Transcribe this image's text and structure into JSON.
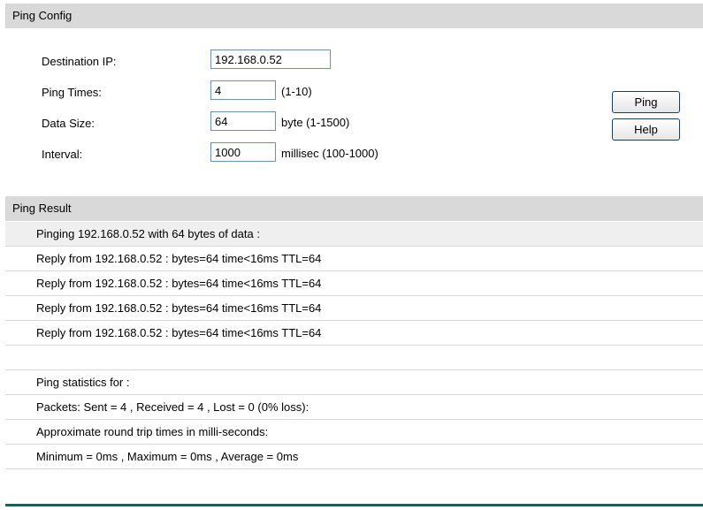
{
  "config": {
    "header": "Ping Config",
    "destination_ip": {
      "label": "Destination IP:",
      "value": "192.168.0.52"
    },
    "ping_times": {
      "label": "Ping Times:",
      "value": "4",
      "hint": "(1-10)"
    },
    "data_size": {
      "label": "Data Size:",
      "value": "64",
      "hint": "byte (1-1500)"
    },
    "interval": {
      "label": "Interval:",
      "value": "1000",
      "hint": "millisec (100-1000)"
    },
    "ping_button": "Ping",
    "help_button": "Help"
  },
  "result": {
    "header": "Ping Result",
    "rows": [
      "Pinging 192.168.0.52 with 64 bytes of data :",
      "Reply from 192.168.0.52 : bytes=64 time<16ms TTL=64",
      "Reply from 192.168.0.52 : bytes=64 time<16ms TTL=64",
      "Reply from 192.168.0.52 : bytes=64 time<16ms TTL=64",
      "Reply from 192.168.0.52 : bytes=64 time<16ms TTL=64",
      "",
      "Ping statistics for :",
      "Packets: Sent = 4 , Received = 4 , Lost = 0 (0% loss):",
      "Approximate round trip times in milli-seconds:",
      "Minimum = 0ms , Maximum = 0ms , Average = 0ms"
    ]
  }
}
